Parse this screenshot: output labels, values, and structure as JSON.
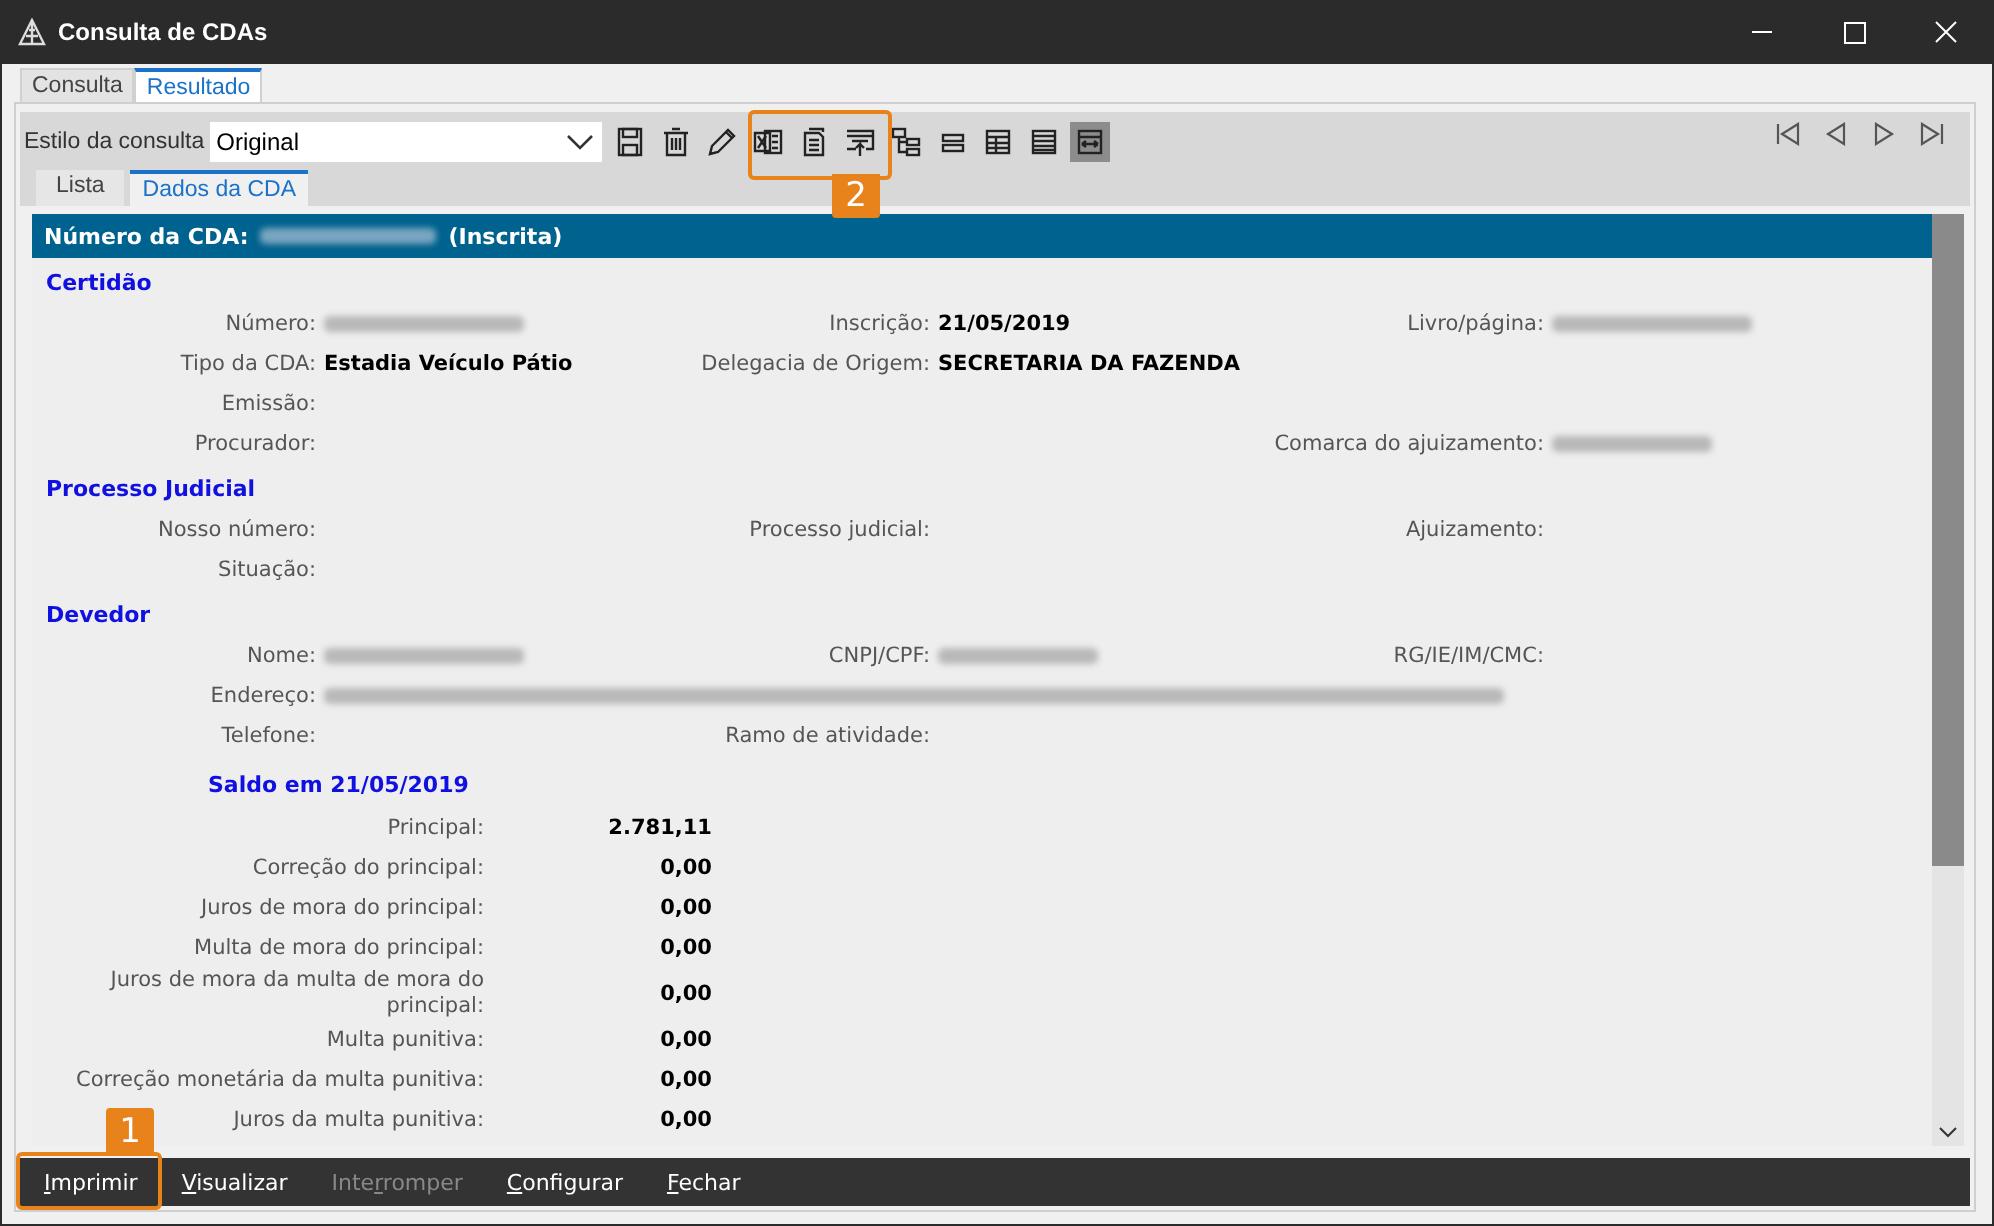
{
  "window": {
    "title": "Consulta de CDAs"
  },
  "tabs": [
    {
      "label": "Consulta",
      "selected": false
    },
    {
      "label": "Resultado",
      "selected": true
    }
  ],
  "toolbar": {
    "style_label": "Estilo da consulta",
    "style_value": "Original",
    "buttons": [
      {
        "kind": "save",
        "selected": false
      },
      {
        "kind": "delete",
        "selected": false
      },
      {
        "kind": "edit",
        "selected": false
      },
      {
        "kind": "spreadsheet",
        "selected": false
      },
      {
        "kind": "document",
        "selected": false
      },
      {
        "kind": "export",
        "selected": false
      },
      {
        "kind": "tree",
        "selected": false
      },
      {
        "kind": "collapse",
        "selected": false
      },
      {
        "kind": "grid",
        "selected": false
      },
      {
        "kind": "list",
        "selected": false
      },
      {
        "kind": "fit",
        "selected": true
      }
    ],
    "navigation": [
      {
        "kind": "first"
      },
      {
        "kind": "previous"
      },
      {
        "kind": "next"
      },
      {
        "kind": "last"
      }
    ]
  },
  "subtabs": [
    {
      "label": "Lista",
      "selected": false
    },
    {
      "label": "Dados da CDA",
      "selected": true
    }
  ],
  "record": {
    "header_label": "Número da CDA:",
    "header_status": "(Inscrita)",
    "sections": [
      {
        "title": "Certidão",
        "rows": [
          [
            {
              "label": "Número:",
              "kind": "redacted"
            },
            {
              "label": "Inscrição:",
              "kind": "text",
              "value": "21/05/2019"
            },
            {
              "label": "Livro/página:",
              "kind": "redacted"
            }
          ],
          [
            {
              "label": "Tipo da CDA:",
              "kind": "text",
              "value": "Estadia Veículo Pátio"
            },
            {
              "label": "Delegacia de Origem:",
              "kind": "text",
              "value": "SECRETARIA DA FAZENDA"
            }
          ],
          [
            {
              "label": "Emissão:",
              "kind": "empty"
            }
          ],
          [
            {
              "label": "Procurador:",
              "kind": "empty"
            },
            null,
            {
              "label": "Comarca do ajuizamento:",
              "kind": "redacted"
            }
          ]
        ]
      },
      {
        "title": "Processo Judicial",
        "rows": [
          [
            {
              "label": "Nosso número:",
              "kind": "empty"
            },
            {
              "label": "Processo judicial:",
              "kind": "empty"
            },
            {
              "label": "Ajuizamento:",
              "kind": "empty"
            }
          ],
          [
            {
              "label": "Situação:",
              "kind": "empty"
            }
          ]
        ]
      },
      {
        "title": "Devedor",
        "rows": [
          [
            {
              "label": "Nome:",
              "kind": "redacted"
            },
            {
              "label": "CNPJ/CPF:",
              "kind": "redacted"
            },
            {
              "label": "RG/IE/IM/CMC:",
              "kind": "empty"
            }
          ],
          [
            {
              "label": "Endereço:",
              "kind": "redacted"
            }
          ],
          [
            {
              "label": "Telefone:",
              "kind": "empty"
            },
            {
              "label": "Ramo de atividade:",
              "kind": "empty"
            }
          ]
        ]
      }
    ],
    "balance": {
      "title": "Saldo em 21/05/2019",
      "items": [
        {
          "label": "Principal:",
          "value": "2.781,11"
        },
        {
          "label": "Correção do principal:",
          "value": "0,00"
        },
        {
          "label": "Juros de mora do principal:",
          "value": "0,00"
        },
        {
          "label": "Multa de mora do principal:",
          "value": "0,00"
        },
        {
          "label": "Juros de mora da multa de mora do principal:",
          "value": "0,00"
        },
        {
          "label": "Multa punitiva:",
          "value": "0,00"
        },
        {
          "label": "Correção monetária da multa punitiva:",
          "value": "0,00"
        },
        {
          "label": "Juros da multa punitiva:",
          "value": "0,00"
        }
      ]
    }
  },
  "actions": [
    {
      "access_key": "I",
      "label_rest": "mprimir",
      "disabled": false
    },
    {
      "access_key": "V",
      "label_rest": "isualizar",
      "disabled": false
    },
    {
      "label_start": "Inte",
      "access_key": "r",
      "label_rest": "romper",
      "disabled": true
    },
    {
      "access_key": "C",
      "label_rest": "onfigurar",
      "disabled": false
    },
    {
      "access_key": "F",
      "label_rest": "echar",
      "disabled": false
    }
  ],
  "callouts": [
    {
      "label": "1"
    },
    {
      "label": "2"
    }
  ]
}
